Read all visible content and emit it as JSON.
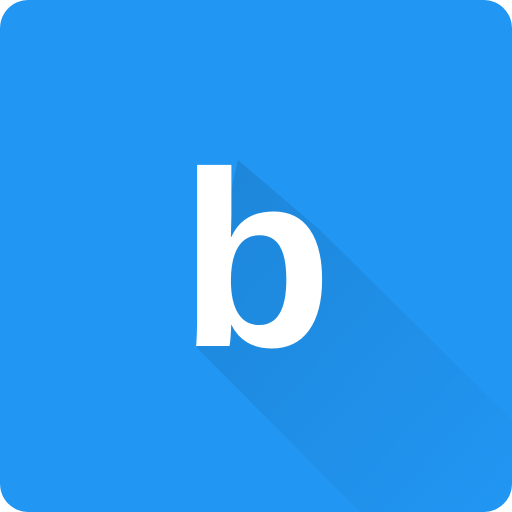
{
  "icon": {
    "name": "letter-b-app-icon",
    "letter": "b",
    "colors": {
      "background": "#2196F3",
      "shadow": "#1A78C2",
      "letter": "#FFFFFF"
    }
  }
}
